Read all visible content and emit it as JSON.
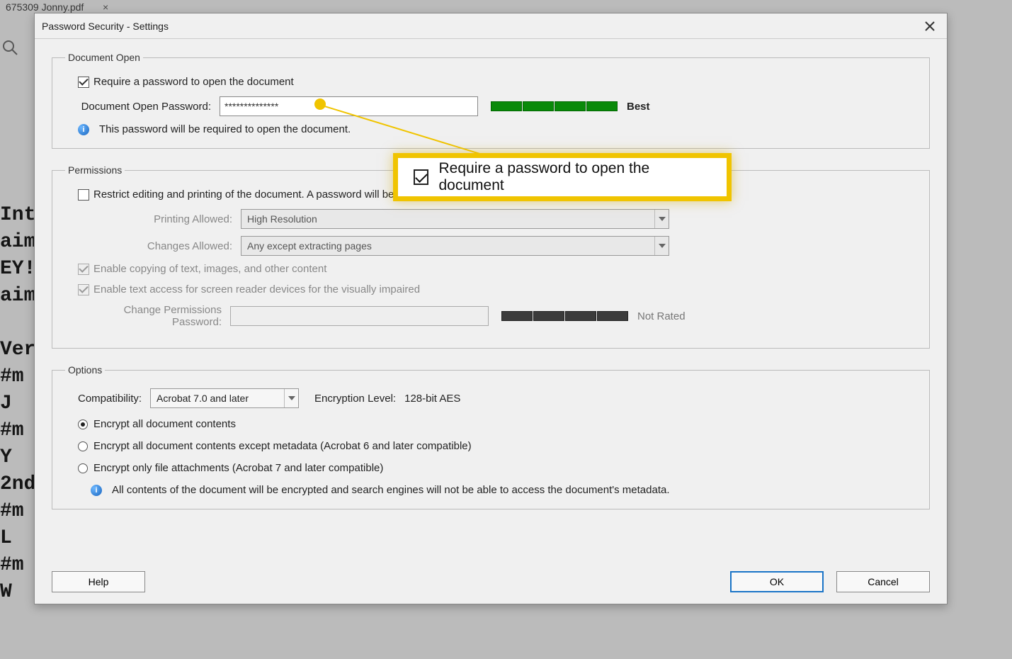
{
  "background": {
    "tab_filename": "675309 Jonny.pdf",
    "obscured_lines": [
      "Int",
      "aim",
      "EY!",
      "aim",
      "Ver",
      "#m",
      " J",
      "#m",
      " Y",
      "2nd",
      "#m",
      " L",
      "#m",
      " W"
    ]
  },
  "dialog": {
    "title": "Password Security - Settings",
    "document_open": {
      "legend": "Document Open",
      "require_password_label": "Require a password to open the document",
      "password_label": "Document Open Password:",
      "password_value": "**************",
      "strength_label": "Best",
      "info_text": "This password will be required to open the document."
    },
    "permissions": {
      "legend": "Permissions",
      "restrict_label": "Restrict editing and printing of the document. A password will be required in order to change these permission settings.",
      "printing_label": "Printing Allowed:",
      "printing_value": "High Resolution",
      "changes_label": "Changes Allowed:",
      "changes_value": "Any except extracting pages",
      "enable_copy_label": "Enable copying of text, images, and other content",
      "enable_access_label": "Enable text access for screen reader devices for the visually impaired",
      "perm_pw_label": "Change Permissions Password:",
      "perm_strength_label": "Not Rated"
    },
    "options": {
      "legend": "Options",
      "compat_label": "Compatibility:",
      "compat_value": "Acrobat 7.0 and later",
      "enc_level_label": "Encryption  Level:",
      "enc_level_value": "128-bit AES",
      "radio1": "Encrypt all document contents",
      "radio2": "Encrypt all document contents except metadata (Acrobat 6 and later compatible)",
      "radio3": "Encrypt only file attachments (Acrobat 7 and later compatible)",
      "info_text": "All contents of the document will be encrypted and search engines will not be able to access the document's metadata."
    },
    "buttons": {
      "help": "Help",
      "ok": "OK",
      "cancel": "Cancel"
    }
  },
  "callout": {
    "text": "Require a password to open the document"
  }
}
